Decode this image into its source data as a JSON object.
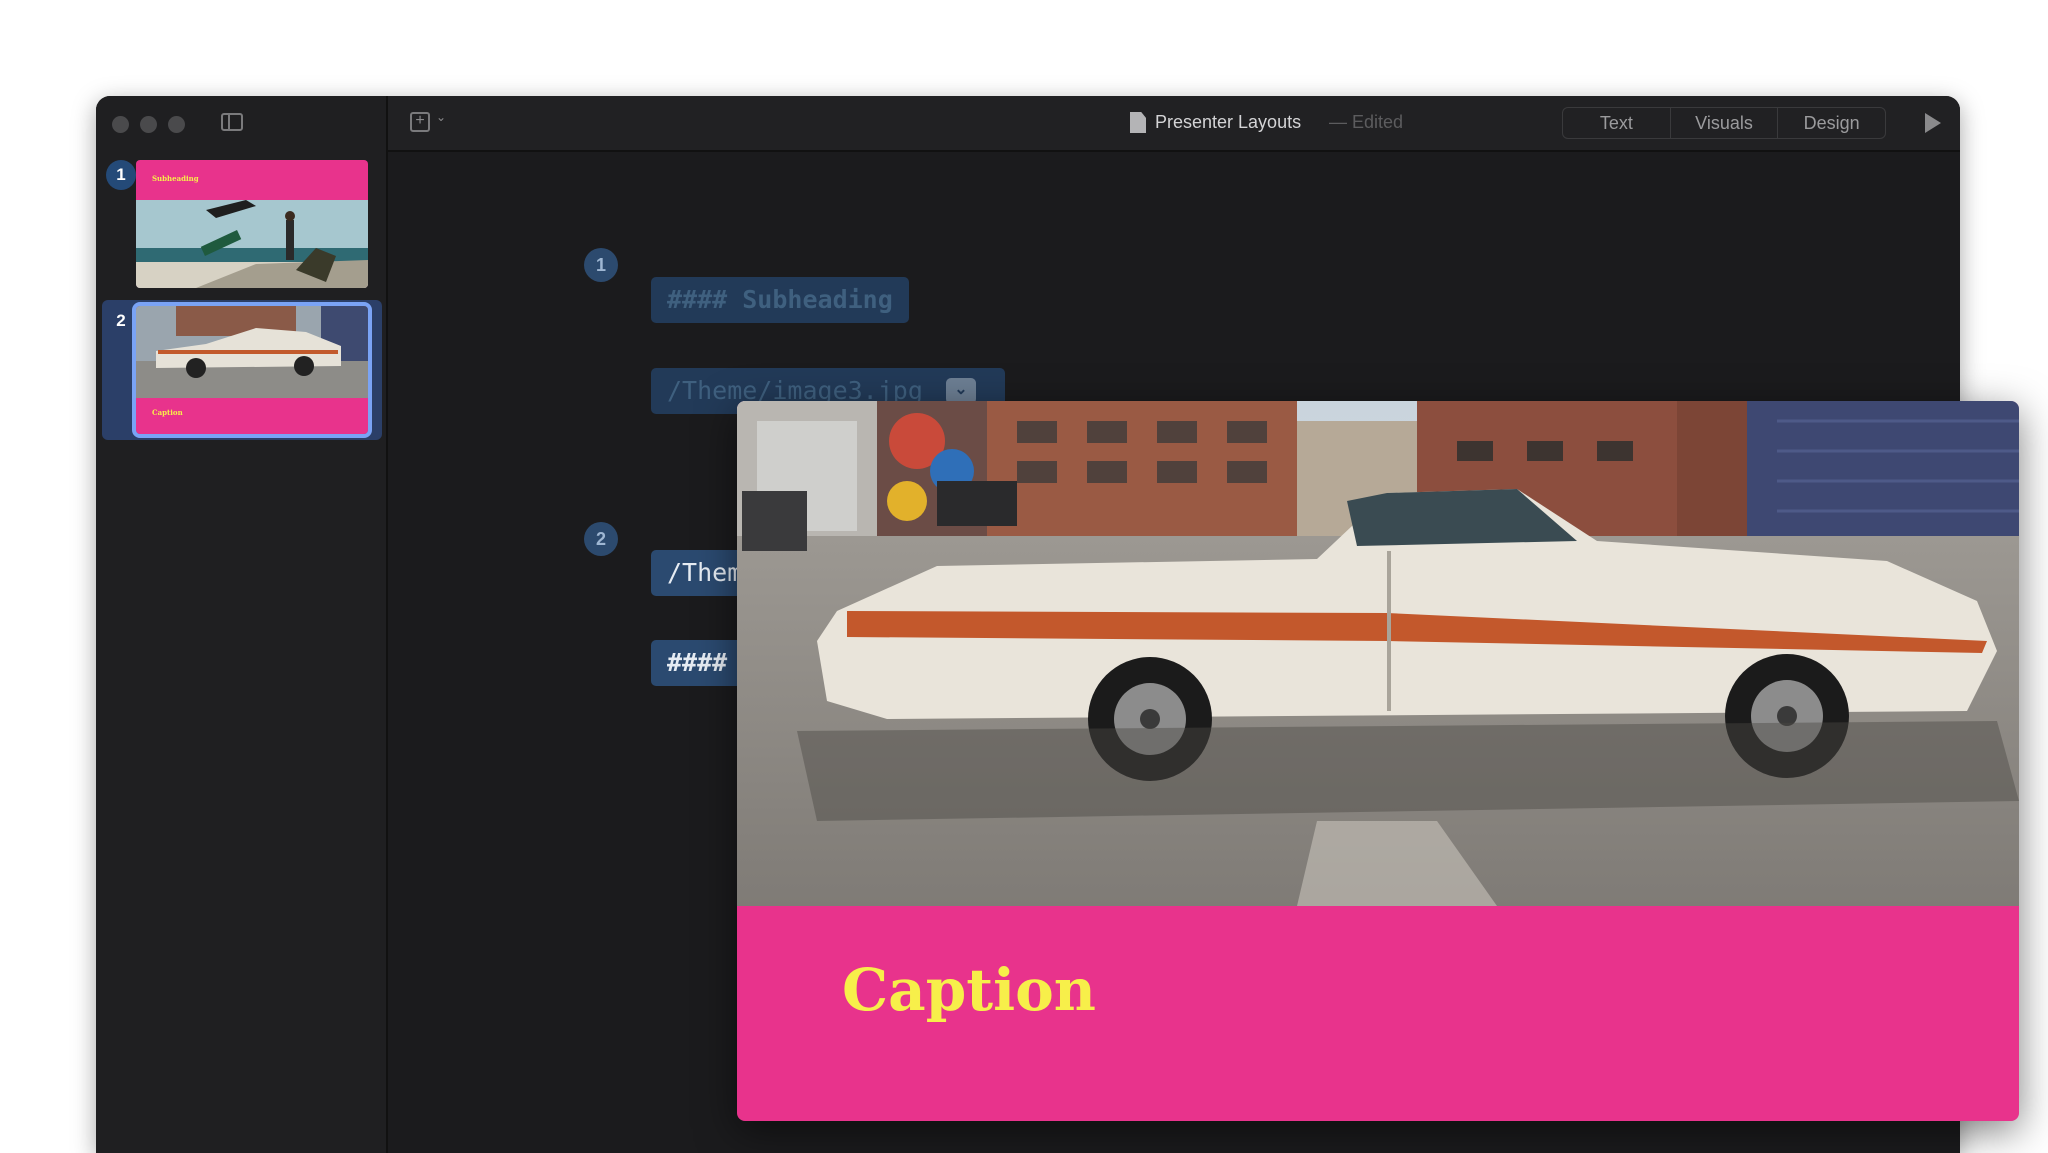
{
  "window": {
    "title": "Presenter Layouts",
    "status": "— Edited"
  },
  "toolbar": {
    "view_tabs": [
      "Text",
      "Visuals",
      "Design"
    ],
    "add_slide_icon": "add-slide-icon",
    "play_icon": "play-icon"
  },
  "slides": [
    {
      "number": "1",
      "title": "Subheading"
    },
    {
      "number": "2",
      "title": "Caption"
    }
  ],
  "editor": {
    "blocks": [
      {
        "number": "1",
        "lines": [
          "#### Subheading",
          "/Theme/image3.jpg"
        ]
      },
      {
        "separator": "---"
      },
      {
        "number": "2",
        "lines": [
          "/Them",
          "####"
        ]
      }
    ]
  },
  "preview": {
    "caption": "Caption"
  },
  "colors": {
    "accent_pink": "#e8338c",
    "caption_yellow": "#f7ef4a",
    "selection_blue": "#2b3f68",
    "window_bg": "#1d1d1f"
  }
}
